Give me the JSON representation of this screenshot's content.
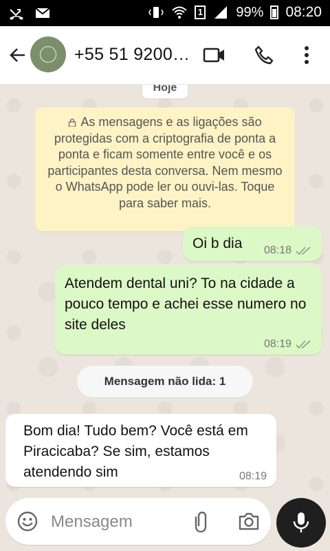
{
  "status_bar": {
    "left_icons": [
      "missed-call-icon",
      "mail-icon"
    ],
    "battery": "99%",
    "time": "08:20",
    "sim_slot": "1"
  },
  "header": {
    "contact_name": "+55 51 9200…",
    "icons": [
      "back-arrow-icon",
      "video-call-icon",
      "phone-icon",
      "more-options-icon"
    ]
  },
  "chat": {
    "date_chip": "Hoje",
    "encryption_notice": "As mensagens e as ligações são protegidas com a criptografia de ponta a ponta e ficam somente entre você e os participantes desta conversa. Nem mesmo o WhatsApp pode ler ou ouvi-las. Toque para saber mais.",
    "messages": [
      {
        "direction": "outgoing",
        "text": "Oi b dia",
        "time": "08:18",
        "status": "delivered"
      },
      {
        "direction": "outgoing",
        "text": "Atendem dental uni? To na cidade a pouco tempo e achei esse numero no site deles",
        "time": "08:19",
        "status": "delivered"
      },
      {
        "direction": "incoming",
        "text": "Bom dia! Tudo bem? Você está em Piracicaba? Se sim, estamos atendendo sim",
        "time": "08:19"
      }
    ],
    "unread_label": "Mensagem não lida: 1"
  },
  "composer": {
    "placeholder": "Mensagem",
    "icons": [
      "emoji-icon",
      "attach-icon",
      "camera-icon",
      "mic-icon"
    ]
  },
  "colors": {
    "outgoing_bubble": "#dcf8c6",
    "incoming_bubble": "#ffffff",
    "encryption_bg": "#fdf3c5",
    "chat_bg": "#ece5dd",
    "mic_button": "#1f1f1f"
  }
}
